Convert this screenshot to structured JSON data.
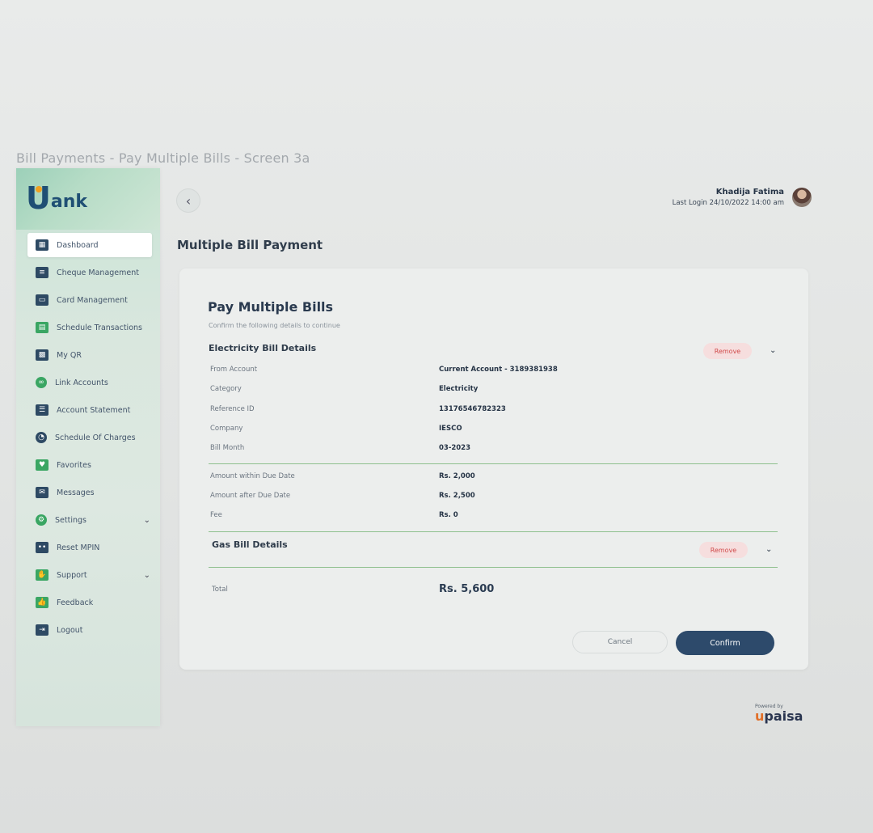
{
  "caption": "Bill Payments - Pay Multiple Bills - Screen 3a",
  "brand": {
    "logo_first": "U",
    "logo_rest": "ank"
  },
  "sidebar": {
    "items": [
      {
        "label": "Dashboard",
        "icon": "dashboard-icon"
      },
      {
        "label": "Cheque Management",
        "icon": "cheque-icon"
      },
      {
        "label": "Card Management",
        "icon": "card-icon"
      },
      {
        "label": "Schedule Transactions",
        "icon": "calendar-icon"
      },
      {
        "label": "My QR",
        "icon": "qr-icon"
      },
      {
        "label": "Link Accounts",
        "icon": "link-icon"
      },
      {
        "label": "Account Statement",
        "icon": "statement-icon"
      },
      {
        "label": "Schedule Of Charges",
        "icon": "charges-icon"
      },
      {
        "label": "Favorites",
        "icon": "heart-icon"
      },
      {
        "label": "Messages",
        "icon": "message-icon"
      },
      {
        "label": "Settings",
        "icon": "gear-icon"
      },
      {
        "label": "Reset MPIN",
        "icon": "pin-icon"
      },
      {
        "label": "Support",
        "icon": "support-icon"
      },
      {
        "label": "Feedback",
        "icon": "thumbs-up-icon"
      },
      {
        "label": "Logout",
        "icon": "logout-icon"
      }
    ]
  },
  "header": {
    "user_name": "Khadija Fatima",
    "last_login": "Last Login 24/10/2022 14:00 am"
  },
  "page_title": "Multiple Bill Payment",
  "card": {
    "title": "Pay Multiple Bills",
    "subtitle": "Confirm the following details to continue",
    "electricity": {
      "title": "Electricity Bill Details",
      "remove_label": "Remove",
      "rows": [
        {
          "label": "From Account",
          "value": "Current Account - 3189381938"
        },
        {
          "label": "Category",
          "value": "Electricity"
        },
        {
          "label": "Reference ID",
          "value": "13176546782323"
        },
        {
          "label": "Company",
          "value": "IESCO"
        },
        {
          "label": "Bill Month",
          "value": "03-2023"
        }
      ],
      "amounts": [
        {
          "label": "Amount within Due Date",
          "value": "Rs. 2,000"
        },
        {
          "label": "Amount after Due Date",
          "value": "Rs. 2,500"
        },
        {
          "label": "Fee",
          "value": "Rs. 0"
        }
      ]
    },
    "gas": {
      "title": "Gas Bill Details",
      "remove_label": "Remove"
    },
    "total_label": "Total",
    "total_value": "Rs. 5,600",
    "cancel_label": "Cancel",
    "confirm_label": "Confirm"
  },
  "footer": {
    "powered_by": "Powered by",
    "brand_u": "u",
    "brand_rest": "paisa"
  },
  "colors": {
    "primary": "#2d4a6b",
    "accent_green": "#3aa663",
    "remove_red": "#d04a4a"
  }
}
